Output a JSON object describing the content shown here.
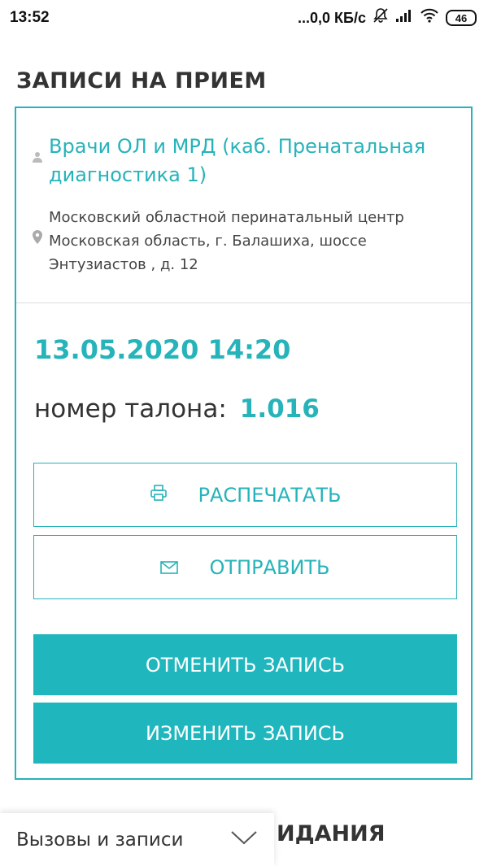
{
  "status_bar": {
    "time": "13:52",
    "network_speed": "...0,0 КБ/с",
    "battery": "46"
  },
  "page_title": "ЗАПИСИ НА ПРИЕМ",
  "appointment": {
    "doctor": "Врачи ОЛ и МРД (каб. Пренатальная диагностика 1)",
    "clinic_address": "Московский областной перинатальный центр Московская область, г. Балашиха, шоссе Энтузиастов , д. 12",
    "datetime": "13.05.2020 14:20",
    "ticket_label": "номер талона:",
    "ticket_number": "1.016"
  },
  "actions": {
    "print_label": "РАСПЕЧАТАТЬ",
    "send_label": "ОТПРАВИТЬ",
    "cancel_label": "ОТМЕНИТЬ ЗАПИСЬ",
    "change_label": "ИЗМЕНИТЬ ЗАПИСЬ"
  },
  "next_section_heading_visible": "ИДАНИЯ",
  "dropdown": {
    "selected": "Вызовы и записи"
  },
  "colors": {
    "accent": "#26b3ba",
    "button_fill": "#20b6bd"
  },
  "icons": [
    "person-icon",
    "location-pin-icon",
    "printer-icon",
    "envelope-icon",
    "chevron-down-icon",
    "bell-off-icon",
    "signal-icon",
    "wifi-icon"
  ]
}
